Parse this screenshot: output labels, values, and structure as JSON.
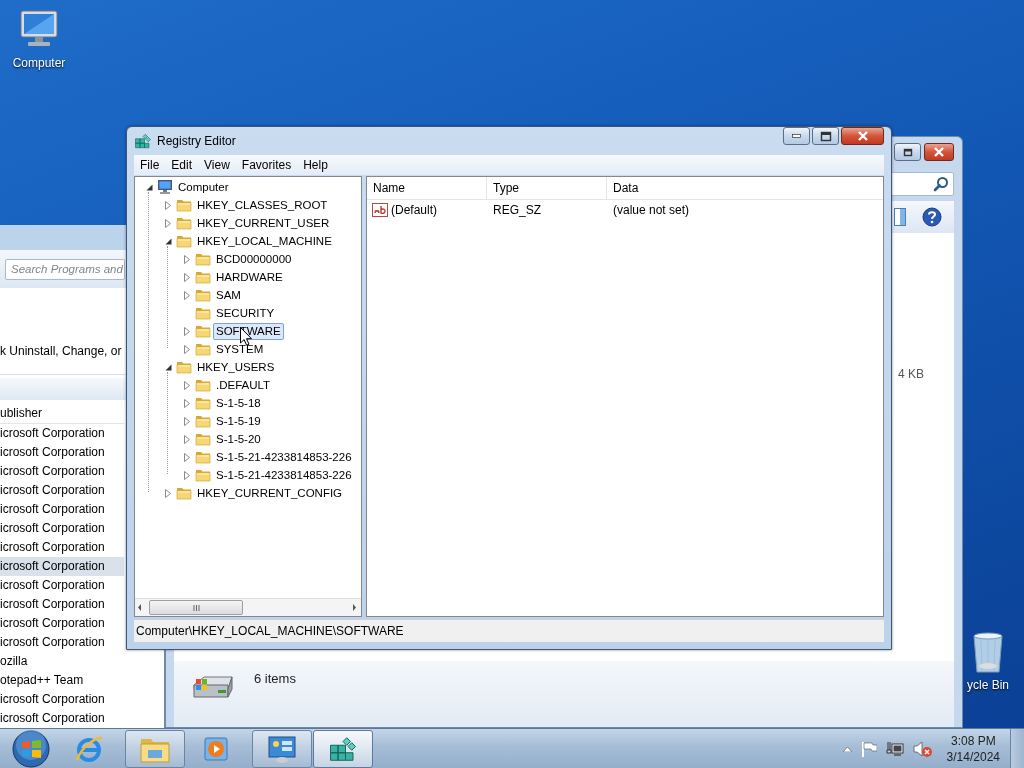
{
  "desktop_icons": [
    {
      "kind": "computer",
      "label": "Computer"
    },
    {
      "kind": "recycle-bin",
      "label": "ycle Bin"
    }
  ],
  "programs_window": {
    "search": {
      "placeholder": "Search Programs and"
    },
    "instruction": "k Uninstall, Change, or",
    "column_header": "ublisher",
    "rows": [
      {
        "publisher": "icrosoft Corporation",
        "selected": false
      },
      {
        "publisher": "icrosoft Corporation",
        "selected": false
      },
      {
        "publisher": "icrosoft Corporation",
        "selected": false
      },
      {
        "publisher": "icrosoft Corporation",
        "selected": false
      },
      {
        "publisher": "icrosoft Corporation",
        "selected": false
      },
      {
        "publisher": "icrosoft Corporation",
        "selected": false
      },
      {
        "publisher": "icrosoft Corporation",
        "selected": false
      },
      {
        "publisher": "icrosoft Corporation",
        "selected": true
      },
      {
        "publisher": "icrosoft Corporation",
        "selected": false
      },
      {
        "publisher": "icrosoft Corporation",
        "selected": false
      },
      {
        "publisher": "icrosoft Corporation",
        "selected": false
      },
      {
        "publisher": "icrosoft Corporation",
        "selected": false
      },
      {
        "publisher": "ozilla",
        "selected": false
      },
      {
        "publisher": "otepad++ Team",
        "selected": false
      },
      {
        "publisher": "icrosoft Corporation",
        "selected": false
      },
      {
        "publisher": "icrosoft Corporation",
        "selected": false
      }
    ]
  },
  "explorer_window": {
    "size_text": "4 KB",
    "status": "6 items"
  },
  "registry_editor": {
    "title": "Registry Editor",
    "menu": [
      "File",
      "Edit",
      "View",
      "Favorites",
      "Help"
    ],
    "tree": {
      "label": "Computer",
      "expandable": true,
      "expanded": true,
      "selected": false,
      "children": [
        {
          "label": "HKEY_CLASSES_ROOT",
          "expandable": true,
          "expanded": false,
          "selected": false
        },
        {
          "label": "HKEY_CURRENT_USER",
          "expandable": true,
          "expanded": false,
          "selected": false
        },
        {
          "label": "HKEY_LOCAL_MACHINE",
          "expandable": true,
          "expanded": true,
          "selected": false,
          "children": [
            {
              "label": "BCD00000000",
              "expandable": true,
              "expanded": false,
              "selected": false
            },
            {
              "label": "HARDWARE",
              "expandable": true,
              "expanded": false,
              "selected": false
            },
            {
              "label": "SAM",
              "expandable": true,
              "expanded": false,
              "selected": false
            },
            {
              "label": "SECURITY",
              "expandable": false,
              "expanded": false,
              "selected": false
            },
            {
              "label": "SOFTWARE",
              "expandable": true,
              "expanded": false,
              "selected": true
            },
            {
              "label": "SYSTEM",
              "expandable": true,
              "expanded": false,
              "selected": false
            }
          ]
        },
        {
          "label": "HKEY_USERS",
          "expandable": true,
          "expanded": true,
          "selected": false,
          "children": [
            {
              "label": ".DEFAULT",
              "expandable": true,
              "expanded": false,
              "selected": false
            },
            {
              "label": "S-1-5-18",
              "expandable": true,
              "expanded": false,
              "selected": false
            },
            {
              "label": "S-1-5-19",
              "expandable": true,
              "expanded": false,
              "selected": false
            },
            {
              "label": "S-1-5-20",
              "expandable": true,
              "expanded": false,
              "selected": false
            },
            {
              "label": "S-1-5-21-4233814853-226",
              "expandable": true,
              "expanded": false,
              "selected": false
            },
            {
              "label": "S-1-5-21-4233814853-226",
              "expandable": true,
              "expanded": false,
              "selected": false
            }
          ]
        },
        {
          "label": "HKEY_CURRENT_CONFIG",
          "expandable": true,
          "expanded": false,
          "selected": false
        }
      ]
    },
    "columns": [
      "Name",
      "Type",
      "Data"
    ],
    "values": [
      {
        "name": "(Default)",
        "type": "REG_SZ",
        "data": "(value not set)"
      }
    ],
    "status_bar": "Computer\\HKEY_LOCAL_MACHINE\\SOFTWARE"
  },
  "taskbar": {
    "buttons": [
      {
        "kind": "browser",
        "running": false,
        "selected": false
      },
      {
        "kind": "file-explorer",
        "running": true,
        "selected": false
      },
      {
        "kind": "media-player",
        "running": false,
        "selected": false
      },
      {
        "kind": "control-panel",
        "running": true,
        "selected": false
      },
      {
        "kind": "registry-editor",
        "running": true,
        "selected": true
      }
    ],
    "clock": {
      "time": "3:08 PM",
      "date": "3/14/2024"
    }
  }
}
